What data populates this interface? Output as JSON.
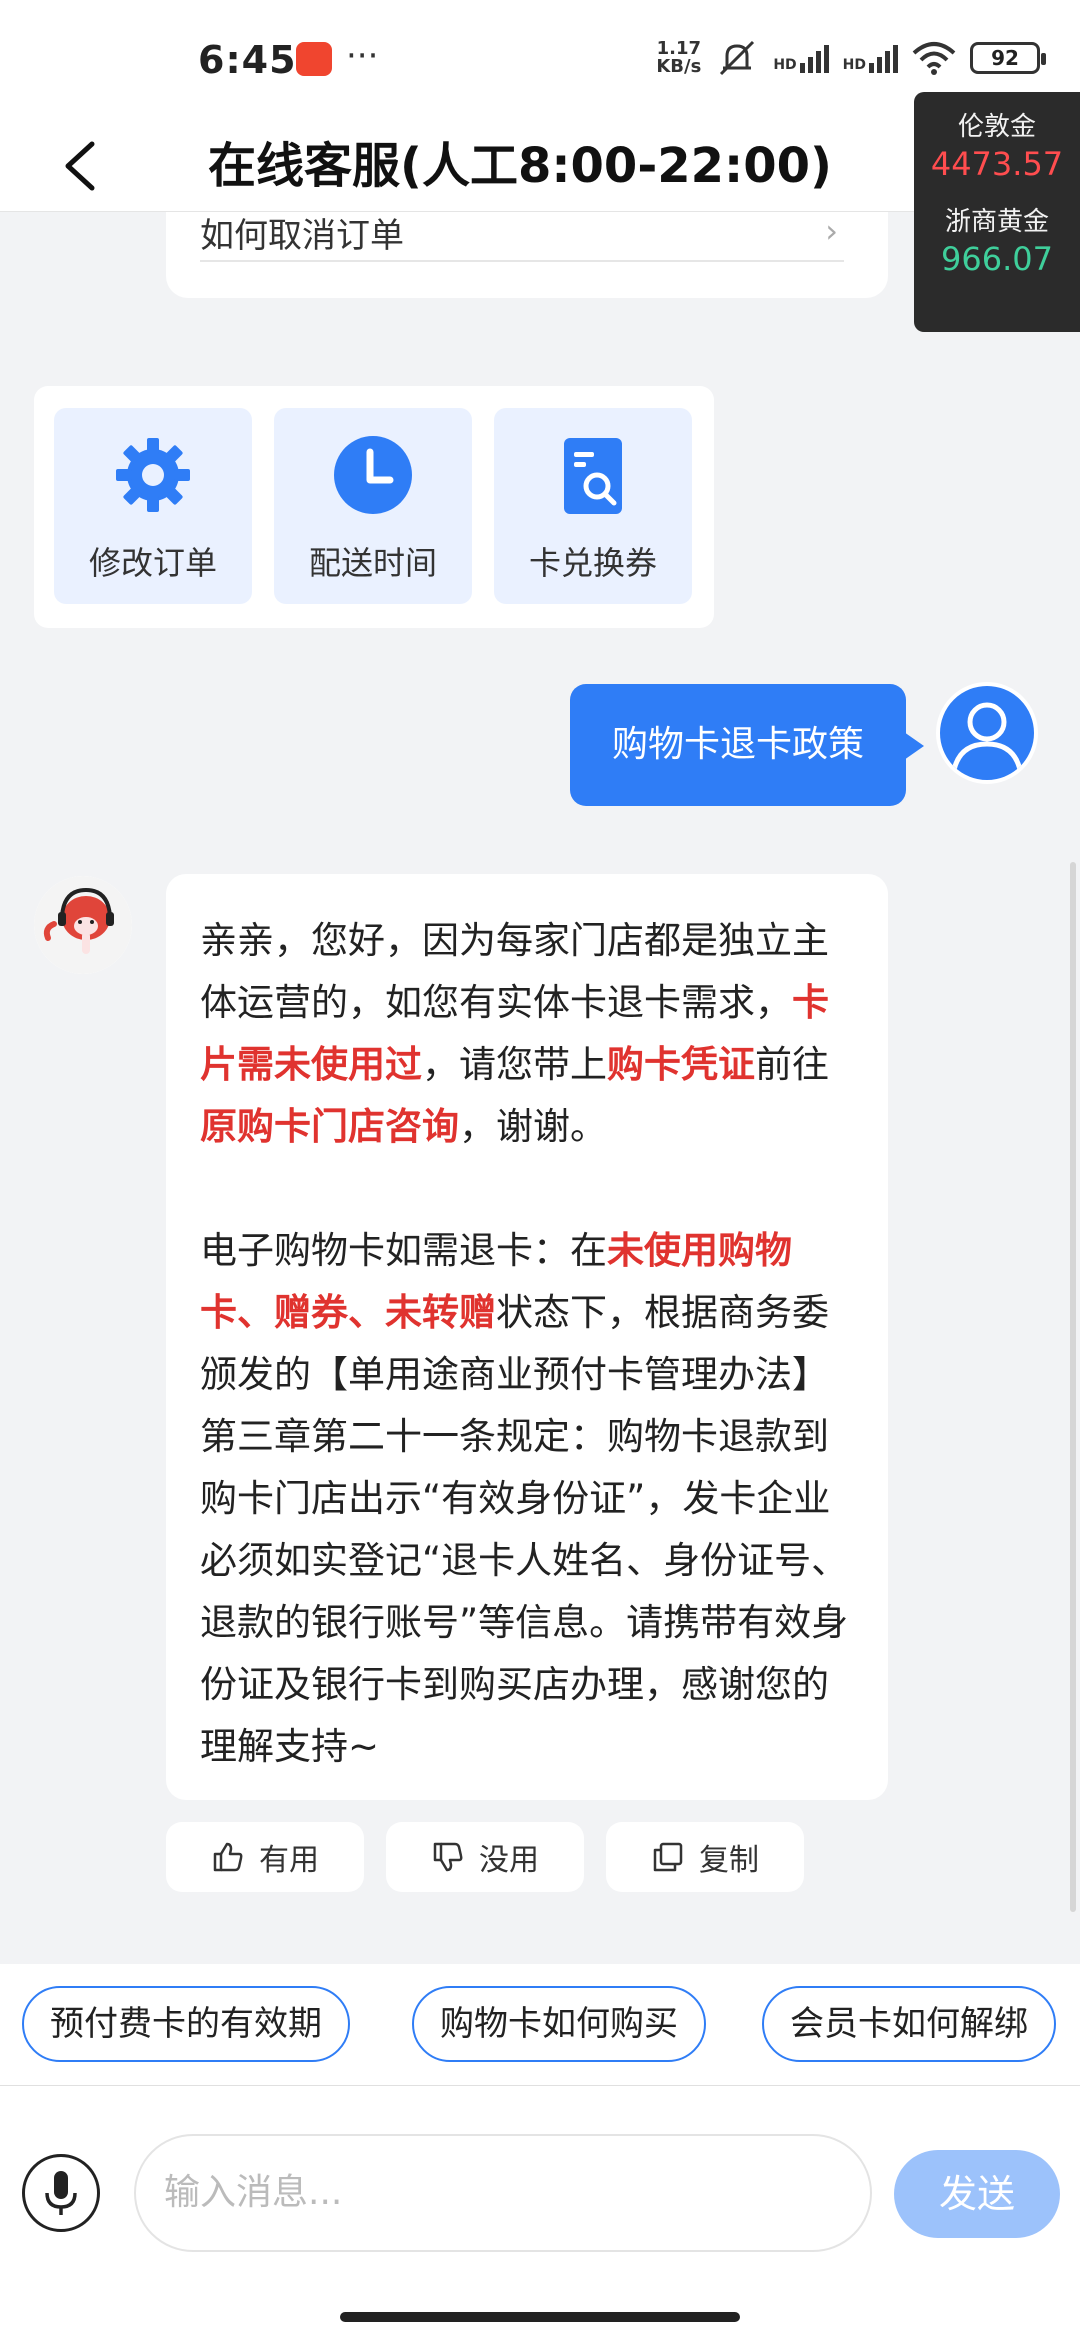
{
  "status_bar": {
    "time": "6:45",
    "dots": "···",
    "net_speed_value": "1.17",
    "net_speed_unit": "KB/s",
    "hd1": "HD",
    "hd2": "HD",
    "battery": "92"
  },
  "header": {
    "title": "在线客服(人工8:00-22:00)"
  },
  "gold_widget": {
    "label1": "伦敦金",
    "value1": "4473.57",
    "label2": "浙商黄金",
    "value2": "966.07"
  },
  "previous_card": {
    "question": "如何取消订单"
  },
  "quick_tiles": [
    {
      "label": "修改订单",
      "icon": "gear-icon"
    },
    {
      "label": "配送时间",
      "icon": "clock-icon"
    },
    {
      "label": "卡兑换券",
      "icon": "document-search-icon"
    }
  ],
  "user_message": {
    "text": "购物卡退卡政策"
  },
  "bot_message": {
    "p1_a": "亲亲，您好，因为每家门店都是独立主体运营的，如您有实体卡退卡需求，",
    "p1_b": "卡片需未使用过",
    "p1_c": "，请您带上",
    "p1_d": "购卡凭证",
    "p1_e": "前往",
    "p1_f": "原购卡门店咨询",
    "p1_g": "，谢谢。",
    "p2_a": "电子购物卡如需退卡：在",
    "p2_b": "未使用购物卡、赠券、未转赠",
    "p2_c": "状态下，根据商务委颁发的【单用途商业预付卡管理办法】第三章第二十一条规定：购物卡退款到购卡门店出示“有效身份证”，发卡企业必须如实登记“退卡人姓名、身份证号、退款的银行账号”等信息。请携带有效身份证及银行卡到购买店办理，感谢您的理解支持~"
  },
  "feedback": {
    "useful": "有用",
    "useless": "没用",
    "copy": "复制"
  },
  "suggestions": [
    "预付费卡的有效期",
    "购物卡如何购买",
    "会员卡如何解绑"
  ],
  "input": {
    "placeholder": "输入消息...",
    "send_label": "发送"
  },
  "colors": {
    "accent": "#2f7df6",
    "highlight": "#e0332f",
    "send_disabled": "#9cc2fb"
  }
}
